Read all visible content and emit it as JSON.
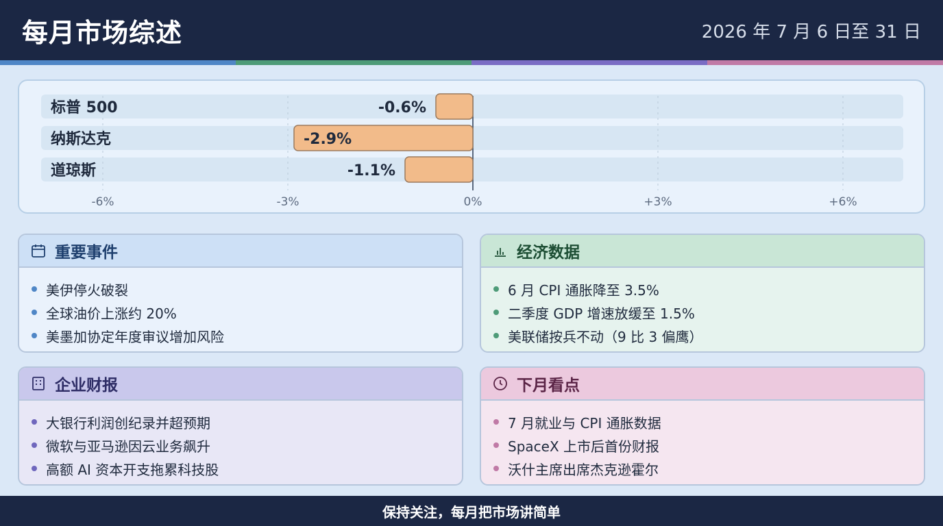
{
  "header": {
    "title": "每月市场综述",
    "date_range": "2026 年 7 月 6 日至 31 日"
  },
  "colors": {
    "header_bg": "#1b2744",
    "stripe": [
      "#4f86c6",
      "#4e9b78",
      "#7a6cc4",
      "#c07aa6"
    ],
    "bar_fill": "#f2bb8a",
    "bar_stroke": "#9a7a5e",
    "track": "#d7e6f3"
  },
  "chart_data": {
    "type": "bar",
    "orientation": "horizontal",
    "categories": [
      "标普 500",
      "纳斯达克",
      "道琼斯"
    ],
    "values": [
      -0.6,
      -2.9,
      -1.1
    ],
    "value_labels": [
      "-0.6%",
      "-2.9%",
      "-1.1%"
    ],
    "xlim": [
      -6,
      6
    ],
    "ticks": [
      -6,
      -3,
      0,
      3,
      6
    ],
    "tick_labels": [
      "-6%",
      "-3%",
      "0%",
      "+3%",
      "+6%"
    ],
    "grid": true
  },
  "panels": [
    {
      "title": "重要事件",
      "icon": "calendar-icon",
      "dot_color": "#4f86c6",
      "items": [
        "美伊停火破裂",
        "全球油价上涨约 20%",
        "美墨加协定年度审议增加风险"
      ]
    },
    {
      "title": "经济数据",
      "icon": "bar-chart-icon",
      "dot_color": "#4e9b78",
      "items": [
        "6 月 CPI 通胀降至 3.5%",
        "二季度 GDP 增速放缓至 1.5%",
        "美联储按兵不动（9 比 3 偏鹰）"
      ]
    },
    {
      "title": "企业财报",
      "icon": "building-icon",
      "dot_color": "#6f67bd",
      "items": [
        "大银行利润创纪录并超预期",
        "微软与亚马逊因云业务飙升",
        "高额 AI 资本开支拖累科技股"
      ]
    },
    {
      "title": "下月看点",
      "icon": "clock-icon",
      "dot_color": "#c07aa6",
      "items": [
        "7 月就业与 CPI 通胀数据",
        "SpaceX 上市后首份财报",
        "沃什主席出席杰克逊霍尔"
      ]
    }
  ],
  "footer": {
    "text": "保持关注，每月把市场讲简单"
  }
}
